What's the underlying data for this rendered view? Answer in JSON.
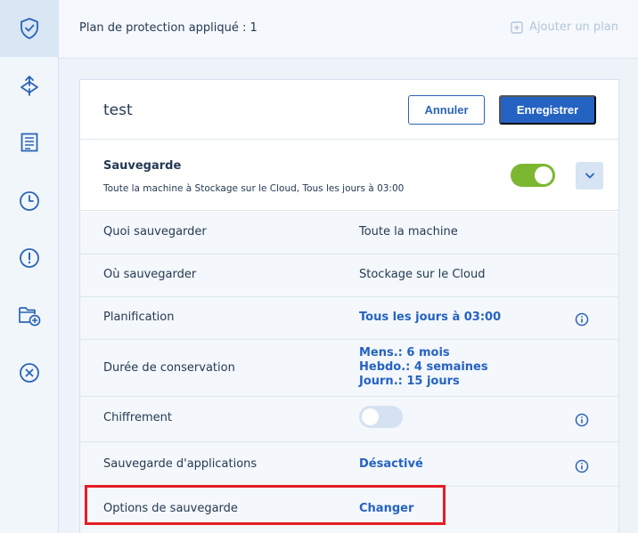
{
  "sidebar": {
    "items": [
      {
        "icon": "shield-check-icon",
        "active": true
      },
      {
        "icon": "recovery-arrows-icon",
        "active": false
      },
      {
        "icon": "list-document-icon",
        "active": false
      },
      {
        "icon": "clock-icon",
        "active": false
      },
      {
        "icon": "alert-circle-icon",
        "active": false
      },
      {
        "icon": "folder-add-icon",
        "active": false
      },
      {
        "icon": "close-circle-icon",
        "active": false
      }
    ]
  },
  "topbar": {
    "plan_count": "Plan de protection appliqué : 1",
    "add_plan": "Ajouter un plan"
  },
  "plan": {
    "name": "test",
    "cancel_label": "Annuler",
    "save_label": "Enregistrer"
  },
  "backup": {
    "title": "Sauvegarde",
    "summary": "Toute la machine à Stockage sur le Cloud, Tous les jours à 03:00",
    "enabled": true
  },
  "rows": {
    "what": {
      "label": "Quoi sauvegarder",
      "value": "Toute la machine"
    },
    "where": {
      "label": "Où sauvegarder",
      "value": "Stockage sur le Cloud"
    },
    "schedule": {
      "label": "Planification",
      "value": "Tous les jours à 03:00"
    },
    "retention": {
      "label": "Durée de conservation",
      "monthly": "Mens.: 6 mois",
      "weekly": "Hebdo.: 4 semaines",
      "daily": "Journ.: 15 jours"
    },
    "encryption": {
      "label": "Chiffrement",
      "enabled": false
    },
    "app_backup": {
      "label": "Sauvegarde d'applications",
      "value": "Désactivé"
    },
    "options": {
      "label": "Options de sauvegarde",
      "value": "Changer"
    }
  },
  "colors": {
    "accent": "#2563c2",
    "toggle_on": "#7cb732",
    "highlight": "#e41e26"
  }
}
